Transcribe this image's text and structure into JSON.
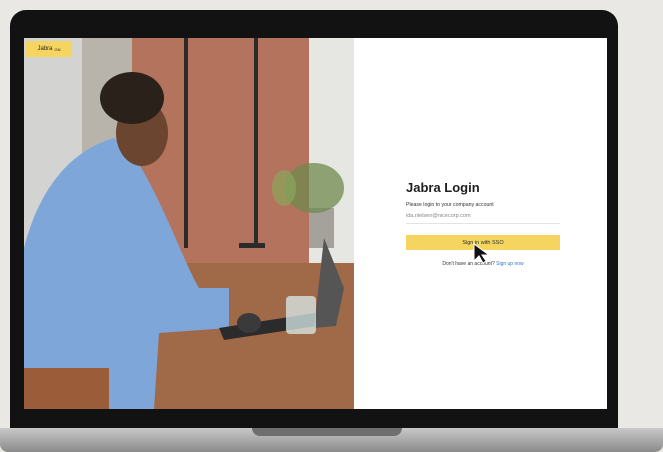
{
  "brand": {
    "logo_text": "Jabra",
    "logo_accent": "GN"
  },
  "login": {
    "title": "Jabra Login",
    "subtitle": "Please login to your company account",
    "email_value": "ida.nielsen@nicecorp.com",
    "sso_label": "Sign in with SSO",
    "no_account_text": "Don't have an account?",
    "signup_link": "Sign up now"
  },
  "colors": {
    "accent": "#F5D560",
    "link": "#3A77C4"
  },
  "icons": {
    "cursor": "arrow-cursor-icon"
  }
}
